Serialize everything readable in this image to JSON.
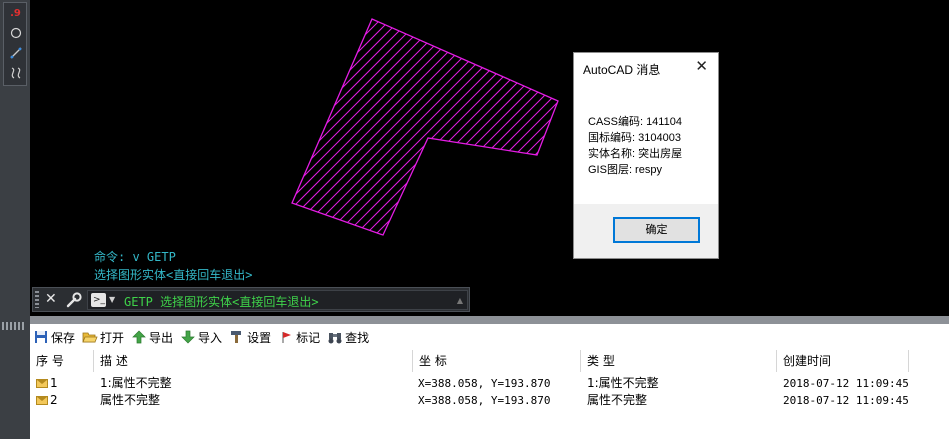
{
  "palette": {
    "icons": [
      "layer-red-icon",
      "circle-icon",
      "line-icon",
      "curve-icon"
    ],
    "badge_text": ".9"
  },
  "canvas": {
    "background": "#000000",
    "polygon_color": "#e31ce3",
    "history": [
      "命令: v GETP",
      "选择图形实体<直接回车退出>"
    ]
  },
  "command_bar": {
    "close_label": "✕",
    "prompt": "GETP 选择图形实体<直接回车退出>"
  },
  "dialog": {
    "title": "AutoCAD 消息",
    "close_label": "✕",
    "lines": [
      "CASS编码: 141104",
      "国标编码: 3104003",
      "实体名称: 突出房屋",
      "GIS图层: respy"
    ],
    "ok_label": "确定"
  },
  "toolbar": {
    "save_label": "保存",
    "open_label": "打开",
    "export_label": "导出",
    "import_label": "导入",
    "settings_label": "设置",
    "mark_label": "标记",
    "find_label": "查找"
  },
  "table": {
    "columns": [
      "序 号",
      "描 述",
      "坐 标",
      "类 型",
      "创建时间"
    ],
    "rows": [
      {
        "index": "1",
        "description": "1:属性不完整",
        "coords": "X=388.058, Y=193.870",
        "type": "1:属性不完整",
        "created": "2018-07-12 11:09:45"
      },
      {
        "index": "2",
        "description": "属性不完整",
        "coords": "X=388.058, Y=193.870",
        "type": "属性不完整",
        "created": "2018-07-12 11:09:45"
      }
    ]
  }
}
